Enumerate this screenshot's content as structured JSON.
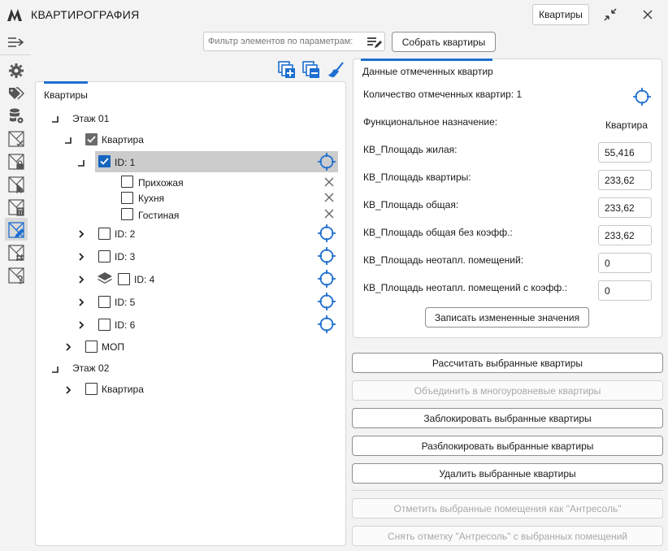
{
  "window": {
    "title": "КВАРТИРОГРАФИЯ",
    "context_button": "Квартиры"
  },
  "toolbar": {
    "filter_placeholder": "Фильтр элементов по параметрам:",
    "collect_button": "Собрать квартиры"
  },
  "tree_panel": {
    "tab_label": "Квартиры",
    "nodes": [
      {
        "label": "Этаж 01"
      },
      {
        "label": "Квартира"
      },
      {
        "label": "ID: 1"
      },
      {
        "label": "Прихожая"
      },
      {
        "label": "Кухня"
      },
      {
        "label": "Гостиная"
      },
      {
        "label": "ID: 2"
      },
      {
        "label": "ID: 3"
      },
      {
        "label": "ID: 4"
      },
      {
        "label": "ID: 5"
      },
      {
        "label": "ID: 6"
      },
      {
        "label": "МОП"
      },
      {
        "label": "Этаж 02"
      },
      {
        "label": "Квартира"
      }
    ]
  },
  "details_panel": {
    "tab_label": "Данные отмеченных квартир",
    "count_label": "Количество отмеченных квартир: 1",
    "function_label": "Функциональное назначение:",
    "function_value": "Квартира",
    "fields": [
      {
        "label": "КВ_Площадь жилая:",
        "value": "55,416"
      },
      {
        "label": "КВ_Площадь квартиры:",
        "value": "233,62"
      },
      {
        "label": "КВ_Площадь общая:",
        "value": "233,62"
      },
      {
        "label": "КВ_Площадь общая без коэфф.:",
        "value": "233,62"
      },
      {
        "label": "КВ_Площадь неотапл. помещений:",
        "value": "0"
      },
      {
        "label": "КВ_Площадь неотапл. помещений с коэфф.:",
        "value": "0"
      }
    ],
    "save_button": "Записать измененные значения"
  },
  "actions": {
    "calculate": "Рассчитать выбранные квартиры",
    "merge": "Объединить в многоуровневые квартиры",
    "lock": "Заблокировать выбранные квартиры",
    "unlock": "Разблокировать выбранные квартиры",
    "delete": "Удалить выбранные квартиры",
    "mark_mezzanine": "Отметить выбранные помещения как \"Антресоль\"",
    "unmark_mezzanine": "Снять отметку \"Антресоль\" с выбранных помещений"
  },
  "colors": {
    "accent": "#1e6fd0",
    "selected_row": "#cccccc",
    "disabled_text": "#a9a9a9"
  }
}
